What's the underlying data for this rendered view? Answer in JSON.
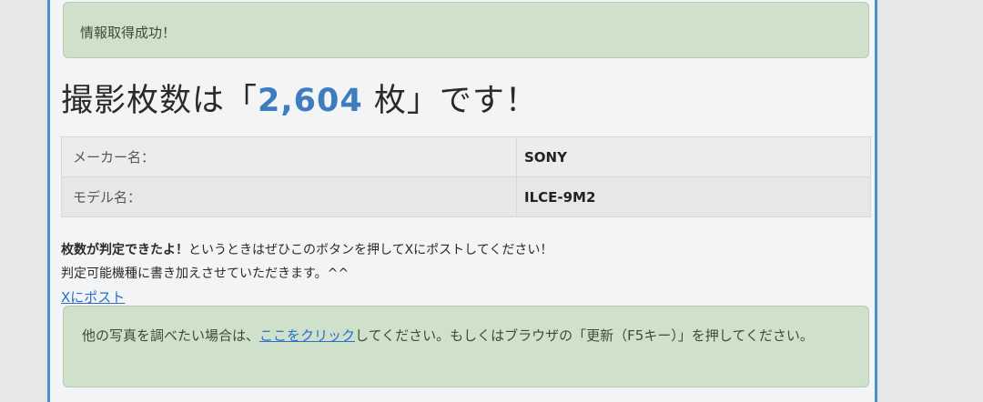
{
  "alert_top": {
    "text": "情報取得成功！"
  },
  "headline": {
    "prefix": "撮影枚数は「",
    "count": "2,604",
    "suffix": " 枚」です！"
  },
  "info_table": [
    {
      "label": "メーカー名：",
      "value": "SONY"
    },
    {
      "label": "モデル名：",
      "value": "ILCE-9M2"
    }
  ],
  "message": {
    "line1_bold": "枚数が判定できたよ！",
    "line1_rest": "というときはぜひこのボタンを押してXにポストしてください！",
    "line2": "判定可能機種に書き加えさせていただきます。^^"
  },
  "post_link": "Xにポスト",
  "alert_bottom": {
    "before_link": "他の写真を調べたい場合は、",
    "link": "ここをクリック",
    "after_link": "してください。もしくはブラウザの「更新（F5キー）」を押してください。"
  }
}
